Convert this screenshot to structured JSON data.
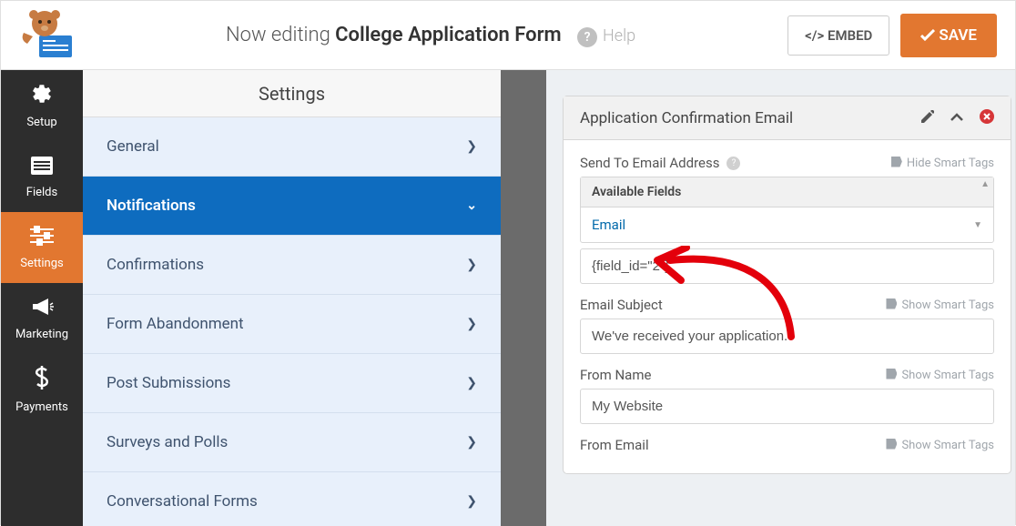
{
  "header": {
    "editing_prefix": "Now editing ",
    "form_name": "College Application Form",
    "help_label": "Help",
    "embed_label": "</> EMBED",
    "save_label": "SAVE"
  },
  "leftnav": [
    {
      "label": "Setup",
      "icon": "gear"
    },
    {
      "label": "Fields",
      "icon": "list"
    },
    {
      "label": "Settings",
      "icon": "sliders",
      "active": true
    },
    {
      "label": "Marketing",
      "icon": "megaphone"
    },
    {
      "label": "Payments",
      "icon": "dollar"
    }
  ],
  "subpanel": {
    "title": "Settings",
    "items": [
      {
        "label": "General"
      },
      {
        "label": "Notifications",
        "active": true,
        "open": true
      },
      {
        "label": "Confirmations"
      },
      {
        "label": "Form Abandonment"
      },
      {
        "label": "Post Submissions"
      },
      {
        "label": "Surveys and Polls"
      },
      {
        "label": "Conversational Forms"
      }
    ]
  },
  "card": {
    "title": "Application Confirmation Email",
    "sendto_label": "Send To Email Address",
    "smart_hide": "Hide Smart Tags",
    "smart_show": "Show Smart Tags",
    "available_fields_label": "Available Fields",
    "available_option": "Email",
    "field_value": "{field_id=\"2\"}",
    "subject_label": "Email Subject",
    "subject_value": "We've received your application.",
    "fromname_label": "From Name",
    "fromname_value": "My Website",
    "fromemail_label": "From Email"
  }
}
